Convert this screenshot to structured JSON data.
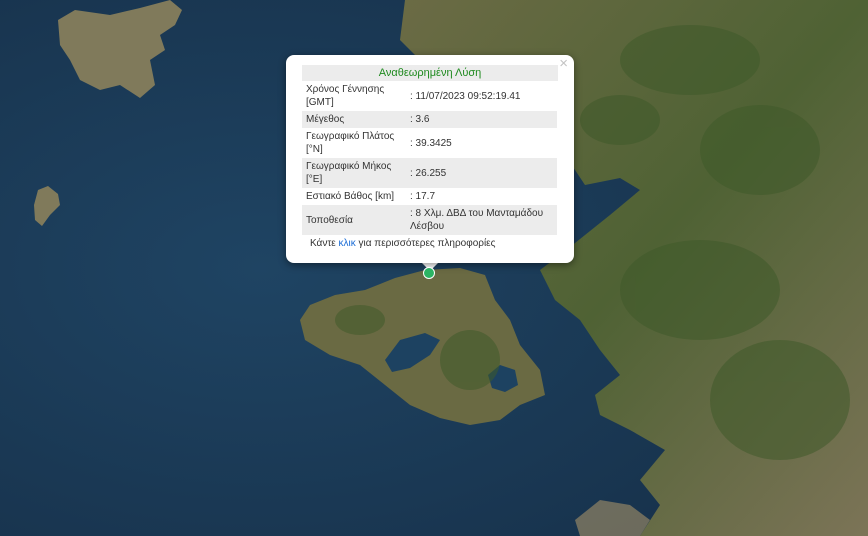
{
  "popup": {
    "title": "Αναθεωρημένη Λύση",
    "close_symbol": "×",
    "rows": [
      {
        "label": "Χρόνος Γέννησης [GMT]",
        "value": ": 11/07/2023 09:52:19.41"
      },
      {
        "label": "Μέγεθος",
        "value": ": 3.6"
      },
      {
        "label": "Γεωγραφικό Πλάτος [°N]",
        "value": ": 39.3425"
      },
      {
        "label": "Γεωγραφικό Μήκος [°E]",
        "value": ": 26.255"
      },
      {
        "label": "Εστιακό Βάθος [km]",
        "value": ": 17.7"
      },
      {
        "label": "Τοποθεσία",
        "value": ": 8 Χλμ. ΔΒΔ του Μανταμάδου Λέσβου"
      }
    ],
    "more_prefix": "Κάντε ",
    "more_link": "κλικ",
    "more_suffix": " για περισσότερες πληροφορίες"
  },
  "colors": {
    "sea": "#1b3a56",
    "land": "#5d6a3c",
    "marker": "#2bb463",
    "title_text": "#1f8a1f",
    "link": "#1a6cd6"
  },
  "marker": {
    "icon": "epicenter-dot-icon"
  }
}
